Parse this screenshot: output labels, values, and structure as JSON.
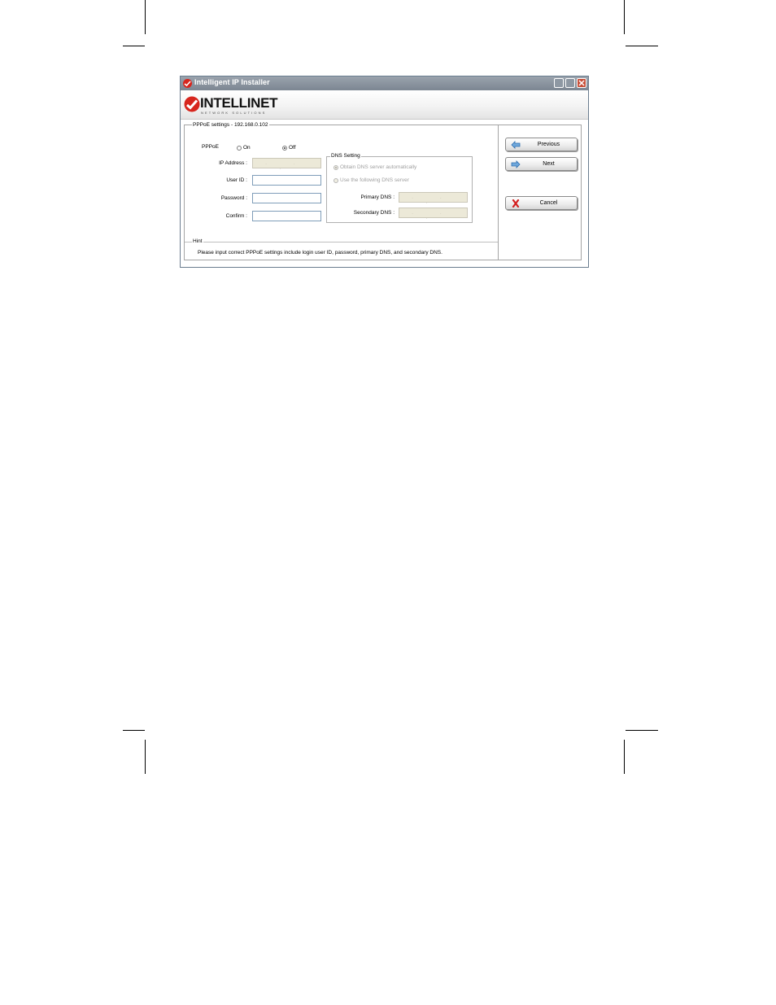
{
  "window": {
    "title": "Intelligent IP Installer",
    "logo_text": "INTELLINET",
    "logo_subtext": "NETWORK SOLUTIONS"
  },
  "pppoe_group": {
    "title": "PPPoE settings - 192.168.0.102",
    "pppoe_label": "PPPoE",
    "on_label": "On",
    "off_label": "Off",
    "selected": "Off",
    "ip_address_label": "IP Address :",
    "user_id_label": "User ID :",
    "password_label": "Password :",
    "confirm_label": "Confirm :",
    "ip_address_value": "",
    "user_id_value": "",
    "password_value": "",
    "confirm_value": ""
  },
  "dns_group": {
    "title": "DNS Setting",
    "auto_label": "Obtain DNS server automatically",
    "manual_label": "Use the following DNS server",
    "selected": "Obtain DNS server automatically",
    "primary_label": "Primary DNS :",
    "secondary_label": "Secondary DNS :"
  },
  "hint": {
    "title": "Hint",
    "text": "Please input correct PPPoE settings include login user ID, password, primary DNS, and secondary DNS."
  },
  "buttons": {
    "previous": "Previous",
    "next": "Next",
    "cancel": "Cancel"
  },
  "icons": {
    "previous": "arrow-left-icon",
    "next": "arrow-right-icon",
    "cancel": "red-x-icon"
  },
  "colors": {
    "arrow_blue": "#3a7fc4",
    "cancel_red": "#d42020",
    "brand_red": "#d7261e"
  }
}
